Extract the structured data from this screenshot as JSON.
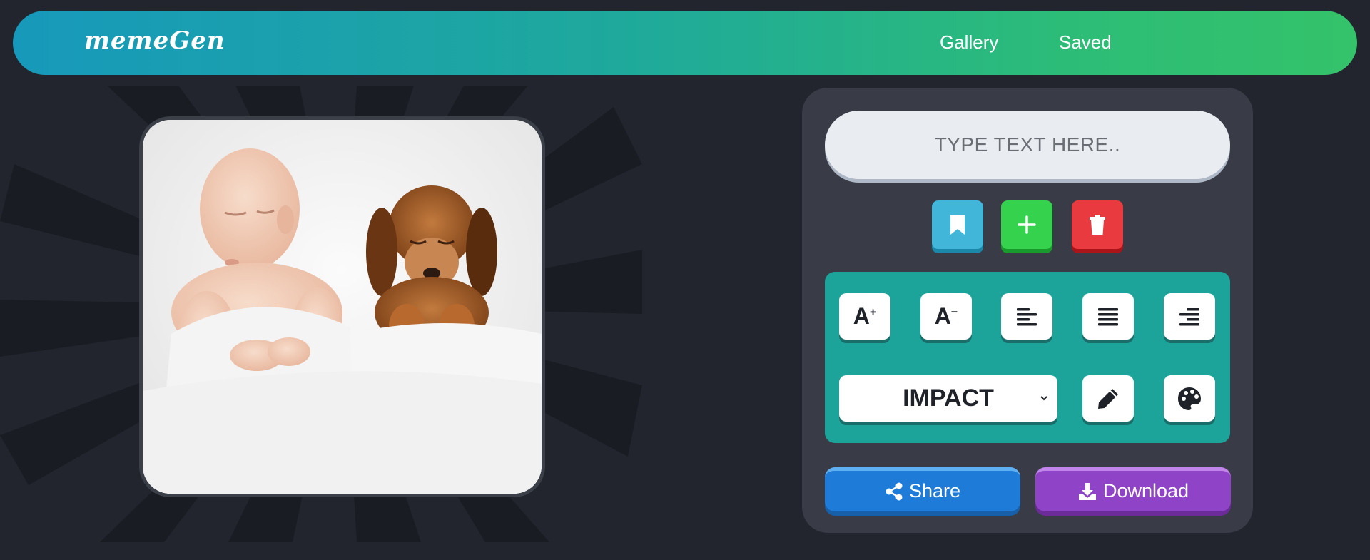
{
  "header": {
    "logo": "memeGen",
    "nav": [
      {
        "label": "Gallery"
      },
      {
        "label": "Saved"
      }
    ]
  },
  "canvas": {
    "image_alt": "sleeping baby and puppy under white blanket"
  },
  "editor": {
    "text_input": {
      "placeholder": "TYPE TEXT HERE..",
      "value": ""
    },
    "actions": {
      "bookmark_icon": "bookmark-icon",
      "add_icon": "plus-icon",
      "delete_icon": "trash-icon"
    },
    "tools": {
      "increase_font": "A",
      "decrease_font": "A",
      "align_left_icon": "align-left-icon",
      "align_center_icon": "align-justify-icon",
      "align_right_icon": "align-right-icon",
      "font": "IMPACT",
      "stroke_icon": "pencil-icon",
      "fill_icon": "palette-icon"
    },
    "share_label": "Share",
    "download_label": "Download"
  },
  "colors": {
    "header_gradient_start": "#1799bb",
    "header_gradient_end": "#34c26a",
    "panel": "#393c47",
    "tool_panel": "#1ca39a",
    "share": "#1f7bd8",
    "download": "#8f43c7",
    "bookmark": "#42b6d8",
    "add": "#35d24d",
    "delete": "#e93b3f"
  }
}
